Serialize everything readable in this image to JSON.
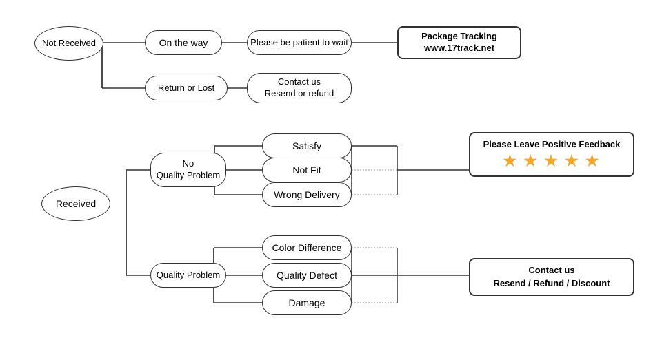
{
  "nodes": {
    "not_received": {
      "label": "Not\nReceived"
    },
    "on_the_way": {
      "label": "On the way"
    },
    "return_or_lost": {
      "label": "Return or Lost"
    },
    "be_patient": {
      "label": "Please be patient to wait"
    },
    "package_tracking": {
      "label": "Package Tracking\nwww.17track.net"
    },
    "contact_resend_refund": {
      "label": "Contact us\nResend or refund"
    },
    "received": {
      "label": "Received"
    },
    "no_quality_problem": {
      "label": "No\nQuality Problem"
    },
    "quality_problem": {
      "label": "Quality Problem"
    },
    "satisfy": {
      "label": "Satisfy"
    },
    "not_fit": {
      "label": "Not Fit"
    },
    "wrong_delivery": {
      "label": "Wrong Delivery"
    },
    "color_difference": {
      "label": "Color Difference"
    },
    "quality_defect": {
      "label": "Quality Defect"
    },
    "damage": {
      "label": "Damage"
    },
    "positive_feedback": {
      "label": "Please Leave Positive Feedback"
    },
    "stars": {
      "label": "★ ★ ★ ★ ★"
    },
    "contact_resend_refund_discount": {
      "label": "Contact us\nResend / Refund / Discount"
    }
  }
}
